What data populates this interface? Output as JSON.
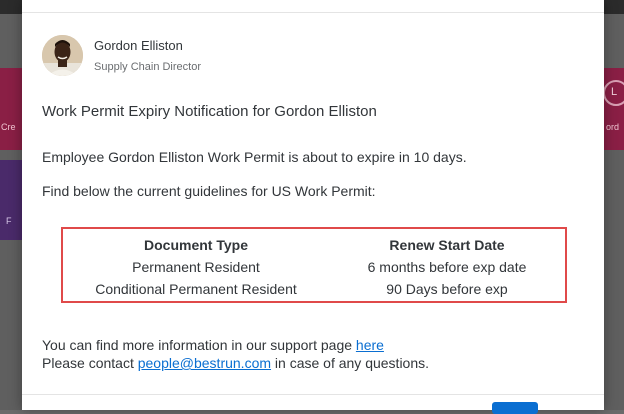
{
  "background": {
    "tile_left_1_text": "Cre",
    "tile_left_2_text": "F",
    "tile_right_1_text": "ord",
    "right_circle_letter": "L"
  },
  "notification": {
    "sender": {
      "name": "Gordon Elliston",
      "title": "Supply Chain Director"
    },
    "subject": "Work Permit Expiry Notification for Gordon Elliston",
    "body_line_1": "Employee Gordon Elliston Work Permit is about to expire in 10 days.",
    "body_line_2": "Find below the current guidelines for US Work Permit:",
    "guidelines": {
      "headers": [
        "Document Type",
        "Renew Start Date"
      ],
      "rows": [
        [
          "Permanent Resident",
          "6 months before exp date"
        ],
        [
          "Conditional Permanent Resident",
          "90 Days before exp"
        ]
      ]
    },
    "footer": {
      "line1_prefix": "You can find more information in our support page ",
      "support_link": "here",
      "line2_prefix": "Please contact ",
      "email_link": "people@bestrun.com",
      "line2_suffix": " in case of any questions."
    }
  },
  "colors": {
    "highlight_border": "#e04a4a",
    "link": "#0a6ed1",
    "text": "#32363a"
  }
}
